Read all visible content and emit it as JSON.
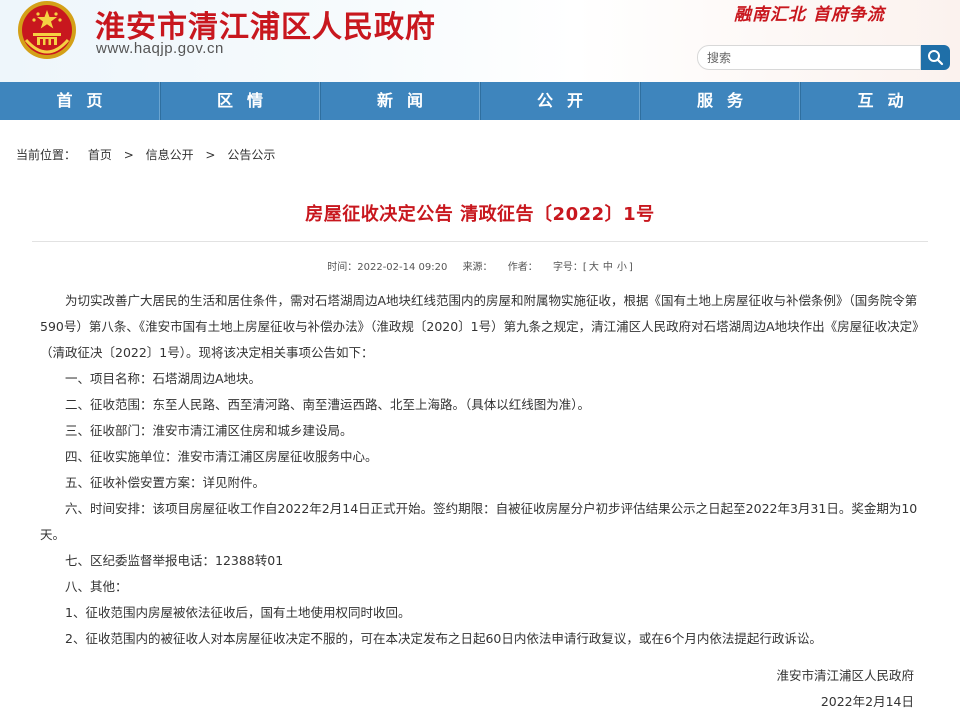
{
  "header": {
    "site_title": "淮安市清江浦区人民政府",
    "site_url": "www.haqjp.gov.cn",
    "slogan": "融南汇北  首府争流",
    "emblem_icon": "national-emblem-icon",
    "accent_color": "#c8171e"
  },
  "search": {
    "placeholder": "搜索",
    "button_icon": "search-icon"
  },
  "nav": {
    "color": "#3e85bd",
    "items": [
      "首页",
      "区情",
      "新闻",
      "公开",
      "服务",
      "互动"
    ]
  },
  "breadcrumb": {
    "prefix": "当前位置：",
    "items": [
      "首页",
      "信息公开",
      "公告公示"
    ],
    "separator": ">"
  },
  "article": {
    "title": "房屋征收决定公告 清政征告〔2022〕1号",
    "meta": {
      "time": "时间：2022-02-14 09:20",
      "source": "来源：",
      "author": "作者：",
      "font_size_label": "字号：[",
      "size_large": "大",
      "size_medium": "中",
      "size_small": "小",
      "size_end": "]"
    },
    "paragraphs": [
      "为切实改善广大居民的生活和居住条件，需对石塔湖周边A地块红线范围内的房屋和附属物实施征收，根据《国有土地上房屋征收与补偿条例》（国务院令第590号）第八条、《淮安市国有土地上房屋征收与补偿办法》（淮政规〔2020〕1号）第九条之规定，清江浦区人民政府对石塔湖周边A地块作出《房屋征收决定》（清政征决〔2022〕1号）。现将该决定相关事项公告如下：",
      "一、项目名称：石塔湖周边A地块。",
      "二、征收范围：东至人民路、西至清河路、南至漕运西路、北至上海路。（具体以红线图为准）。",
      "三、征收部门：淮安市清江浦区住房和城乡建设局。",
      "四、征收实施单位：淮安市清江浦区房屋征收服务中心。",
      "五、征收补偿安置方案：详见附件。",
      "六、时间安排：该项目房屋征收工作自2022年2月14日正式开始。签约期限：自被征收房屋分户初步评估结果公示之日起至2022年3月31日。奖金期为10天。",
      "七、区纪委监督举报电话：12388转01",
      "八、其他：",
      "1、征收范围内房屋被依法征收后，国有土地使用权同时收回。",
      "2、征收范围内的被征收人对本房屋征收决定不服的，可在本决定发布之日起60日内依法申请行政复议，或在6个月内依法提起行政诉讼。"
    ],
    "signature": "淮安市清江浦区人民政府",
    "date": "2022年2月14日"
  }
}
